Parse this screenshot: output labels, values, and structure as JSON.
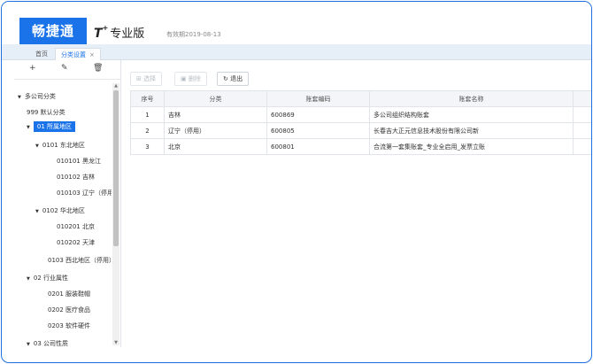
{
  "header": {
    "logo": "畅捷通",
    "product_t": "T",
    "product_plus": "+",
    "product_edition": "专业版",
    "validity": "有效期2019-08-13"
  },
  "tabs": [
    {
      "label": "首页"
    },
    {
      "label": "分类设置",
      "close": "×"
    }
  ],
  "left_toolbar": {
    "add": "+",
    "edit": "✎",
    "delete": "🗑"
  },
  "tree": [
    {
      "caret": "▼",
      "label": "多公司分类"
    },
    {
      "caret": "",
      "label": "999 默认分类"
    },
    {
      "caret": "▼",
      "label": "01 所属地区"
    },
    {
      "caret": "▼",
      "label": "0101 东北地区"
    },
    {
      "caret": "",
      "label": "010101 黑龙江"
    },
    {
      "caret": "",
      "label": "010102 吉林"
    },
    {
      "caret": "",
      "label": "010103 辽宁（停用"
    },
    {
      "caret": "▼",
      "label": "0102 华北地区"
    },
    {
      "caret": "",
      "label": "010201 北京"
    },
    {
      "caret": "",
      "label": "010202 天津"
    },
    {
      "caret": "",
      "label": "0103 西北地区（停用）"
    },
    {
      "caret": "▼",
      "label": "02 行业属性"
    },
    {
      "caret": "",
      "label": "0201 服装鞋帽"
    },
    {
      "caret": "",
      "label": "0202 医疗食品"
    },
    {
      "caret": "",
      "label": "0203 软件硬件"
    },
    {
      "caret": "▼",
      "label": "03 公司性质"
    }
  ],
  "buttons": {
    "select": "选择",
    "delete": "删除",
    "exit": "退出"
  },
  "table": {
    "headers": [
      "序号",
      "分类",
      "账套编码",
      "账套名称"
    ],
    "rows": [
      [
        "1",
        "吉林",
        "600869",
        "多公司组织结构账套"
      ],
      [
        "2",
        "辽宁（停用）",
        "600805",
        "长春吉大正元信息技术股份有限公司新"
      ],
      [
        "3",
        "北京",
        "600801",
        "合流第一套集账套_专业全启用_发票立账"
      ]
    ]
  },
  "scrollbar": {
    "up": "▲",
    "down": "▼"
  },
  "colors": {
    "brand": "#1a73e8",
    "frame": "#1e6fe0"
  }
}
